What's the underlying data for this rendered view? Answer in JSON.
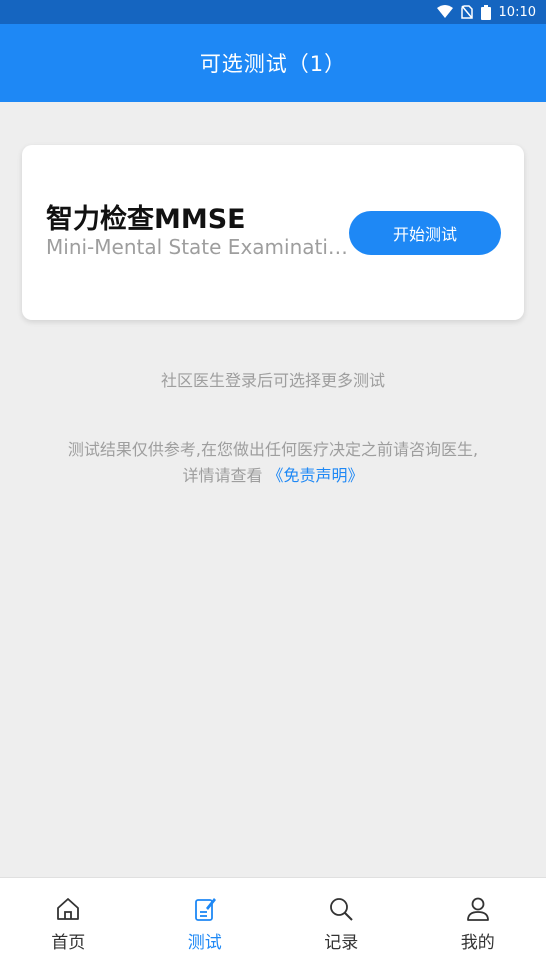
{
  "status_bar": {
    "time": "10:10"
  },
  "header": {
    "title": "可选测试（1）"
  },
  "test_card": {
    "title": "智力检查MMSE",
    "subtitle": "Mini-Mental State Examination",
    "start_label": "开始测试"
  },
  "hint": "社区医生登录后可选择更多测试",
  "disclaimer": {
    "line1": "测试结果仅供参考,在您做出任何医疗决定之前请咨询医生,",
    "line2_prefix": "详情请查看 ",
    "link": "《免责声明》"
  },
  "tabs": [
    {
      "label": "首页",
      "icon": "home-icon"
    },
    {
      "label": "测试",
      "icon": "test-icon",
      "active": true
    },
    {
      "label": "记录",
      "icon": "search-icon"
    },
    {
      "label": "我的",
      "icon": "user-icon"
    }
  ],
  "colors": {
    "primary": "#1e88f5",
    "status_bar": "#1565c0",
    "background": "#eeeeee"
  }
}
